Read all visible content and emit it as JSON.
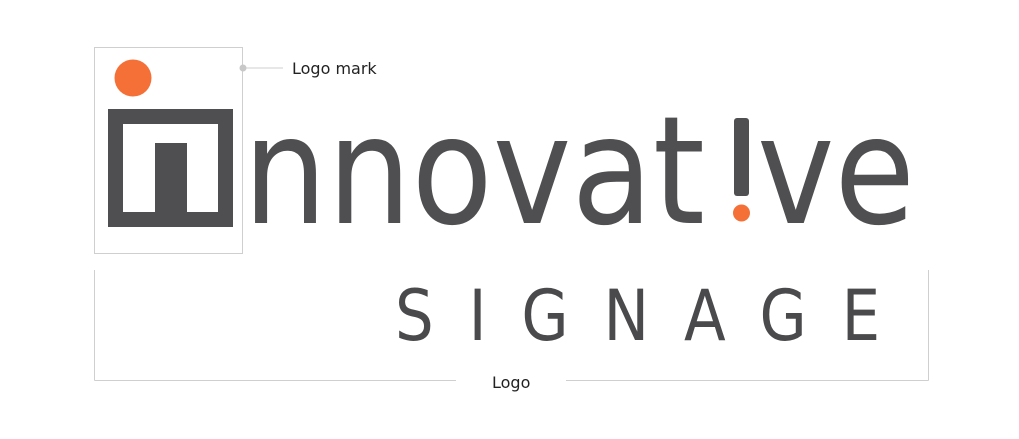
{
  "annotations": {
    "logo_mark": "Logo mark",
    "logo": "Logo"
  },
  "logo": {
    "wordmark": "nnovat",
    "wordmark_end": "ve",
    "tagline": "SIGNAGE"
  },
  "colors": {
    "wordmark": "#4f4f51",
    "tagline": "#4a4a4c",
    "accent": "#f47036",
    "guide_lines": "#cfcfcf",
    "guide_dot": "#c8c8c8",
    "annotation_text": "#222222"
  }
}
